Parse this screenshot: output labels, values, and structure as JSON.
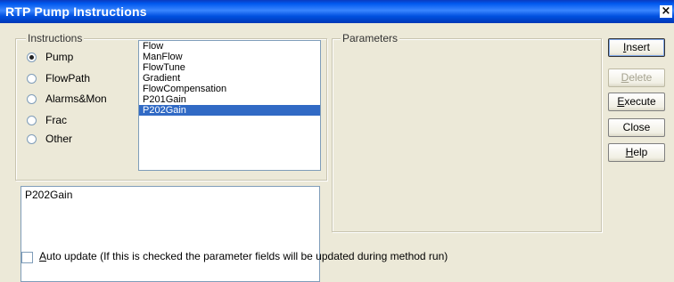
{
  "window": {
    "title": "RTP Pump Instructions",
    "close_glyph": "×"
  },
  "instructions": {
    "group_label": "Instructions",
    "radios": [
      {
        "label": "Pump",
        "checked": true
      },
      {
        "label": "FlowPath",
        "checked": false
      },
      {
        "label": "Alarms&Mon",
        "checked": false
      },
      {
        "label": "Frac",
        "checked": false
      },
      {
        "label": "Other",
        "checked": false
      }
    ],
    "list_items": [
      "Flow",
      "ManFlow",
      "FlowTune",
      "Gradient",
      "FlowCompensation",
      "P201Gain",
      "P202Gain"
    ],
    "selected_item": "P202Gain",
    "text_value": "P202Gain"
  },
  "parameters": {
    "group_label": "Parameters"
  },
  "buttons": {
    "insert_first": "I",
    "insert_rest": "nsert",
    "delete_first": "D",
    "delete_rest": "elete",
    "execute_first": "E",
    "execute_rest": "xecute",
    "close": "Close",
    "help_first": "H",
    "help_rest": "elp"
  },
  "auto_update": {
    "label_first": "A",
    "label_rest": "uto update (If this is checked the parameter fields will be updated during method run)",
    "checked": false
  },
  "colors": {
    "title_bar": "#0058ee",
    "selection": "#316ac5",
    "dialog_bg": "#ece9d8"
  }
}
